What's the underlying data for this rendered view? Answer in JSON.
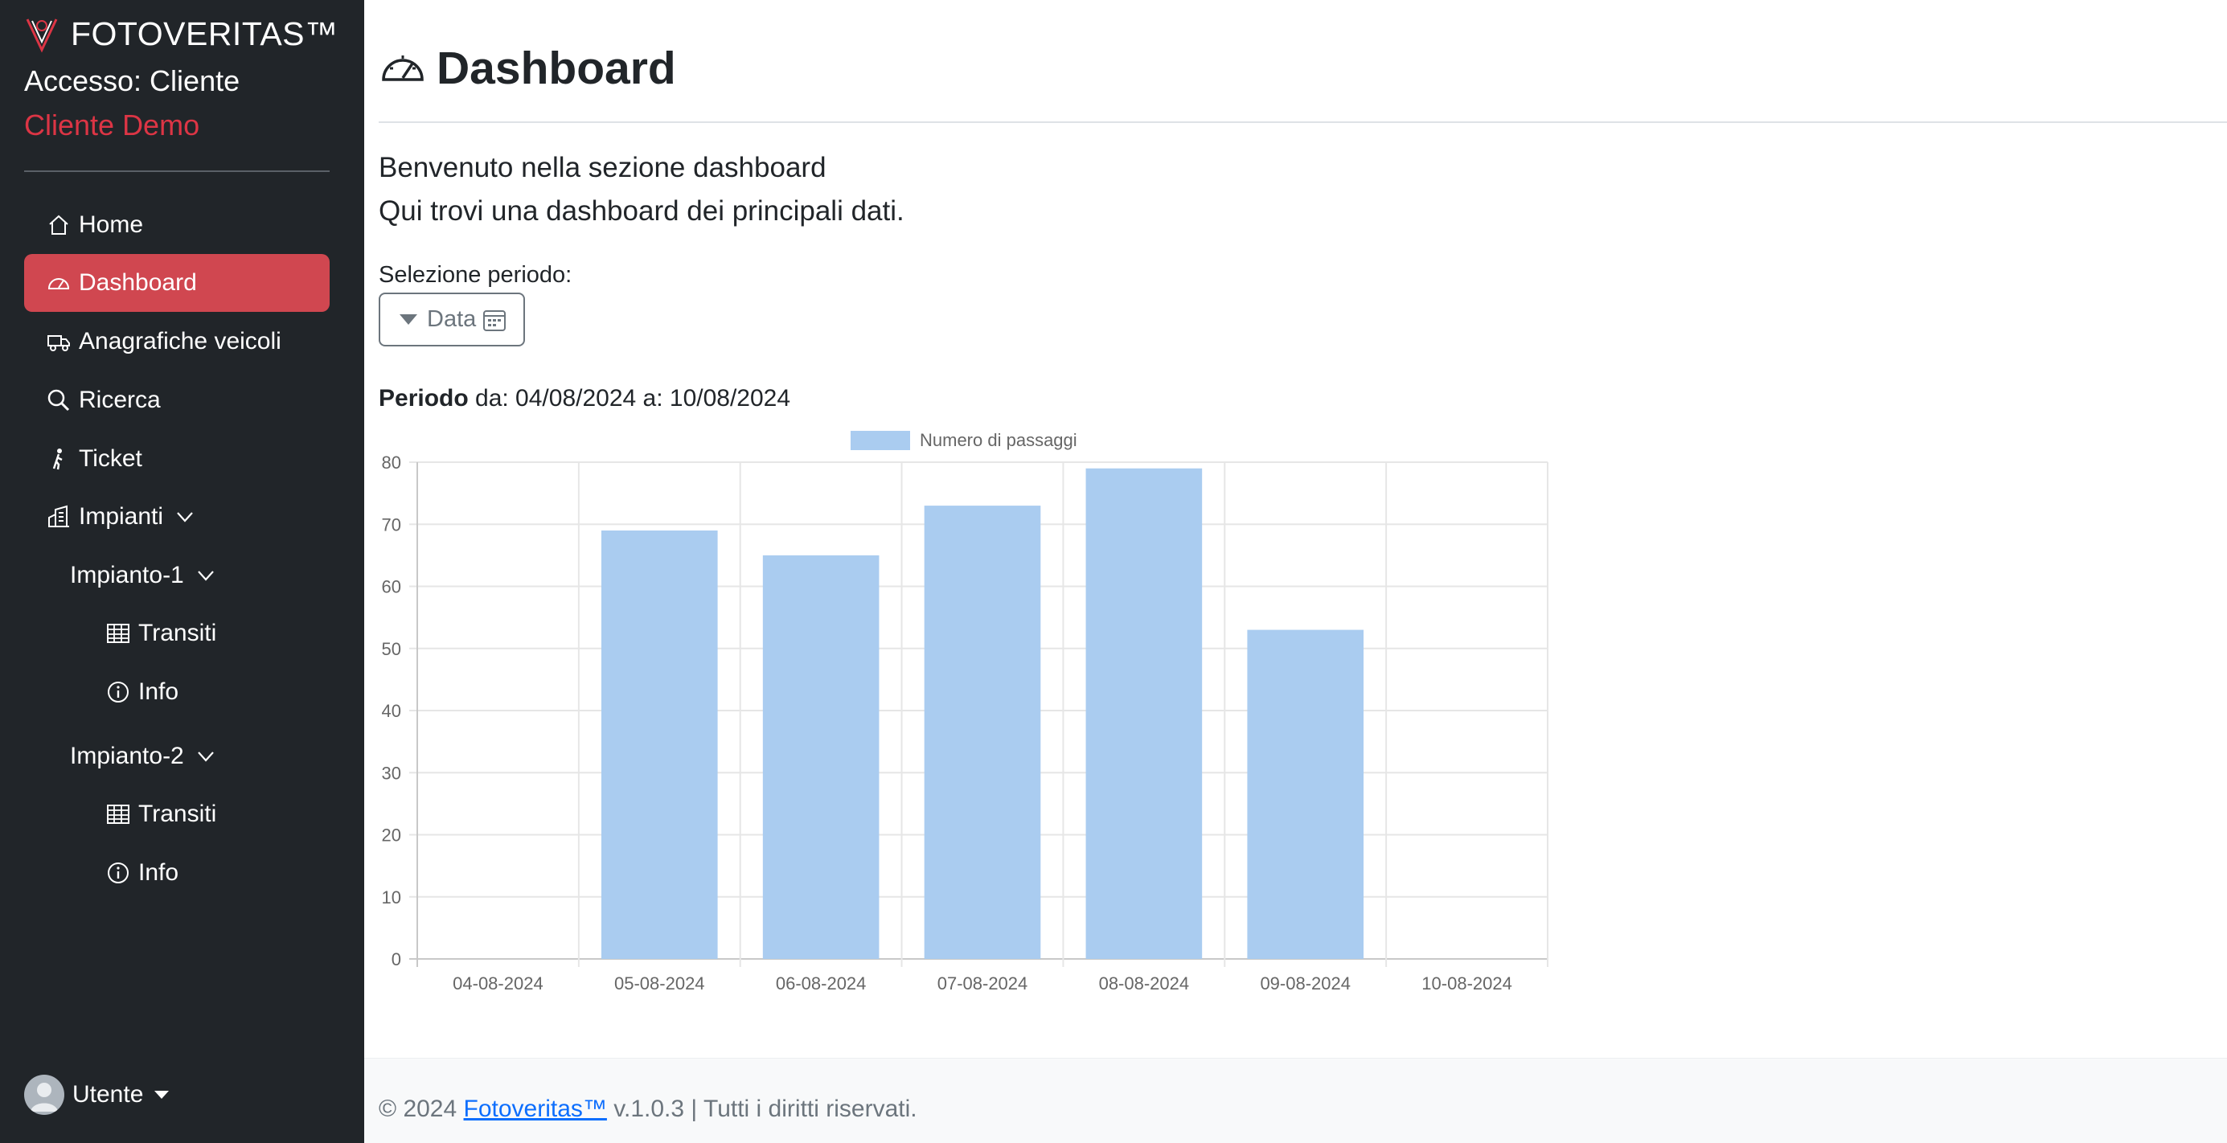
{
  "sidebar": {
    "brand": "FOTOVERITAS™",
    "access": "Accesso: Cliente",
    "client_name": "Cliente Demo",
    "items": [
      {
        "label": "Home",
        "icon": "house-icon"
      },
      {
        "label": "Dashboard",
        "icon": "speedometer-icon",
        "active": true
      },
      {
        "label": "Anagrafiche veicoli",
        "icon": "truck-icon"
      },
      {
        "label": "Ricerca",
        "icon": "search-icon"
      },
      {
        "label": "Ticket",
        "icon": "person-walking-icon"
      },
      {
        "label": "Impianti",
        "icon": "buildings-icon"
      }
    ],
    "plants": [
      {
        "label": "Impianto-1",
        "children": [
          {
            "label": "Transiti",
            "icon": "table-icon"
          },
          {
            "label": "Info",
            "icon": "info-circle-icon"
          }
        ]
      },
      {
        "label": "Impianto-2",
        "children": [
          {
            "label": "Transiti",
            "icon": "table-icon"
          },
          {
            "label": "Info",
            "icon": "info-circle-icon"
          }
        ]
      }
    ],
    "user_label": "Utente"
  },
  "main": {
    "title": "Dashboard",
    "welcome_line1": "Benvenuto nella sezione dashboard",
    "welcome_line2": "Qui trovi una dashboard dei principali dati.",
    "period_selection_label": "Selezione periodo:",
    "date_button": "Data",
    "periodo_bold": "Periodo",
    "periodo_rest": " da: 04/08/2024 a: 10/08/2024"
  },
  "chart_data": {
    "type": "bar",
    "categories": [
      "04-08-2024",
      "05-08-2024",
      "06-08-2024",
      "07-08-2024",
      "08-08-2024",
      "09-08-2024",
      "10-08-2024"
    ],
    "series": [
      {
        "name": "Numero di passaggi",
        "values": [
          0,
          69,
          65,
          73,
          79,
          53,
          0
        ]
      }
    ],
    "ylim": [
      0,
      80
    ],
    "yticks": [
      0,
      10,
      20,
      30,
      40,
      50,
      60,
      70,
      80
    ],
    "grid": true,
    "legend": "top",
    "bar_color": "#aaccf0"
  },
  "footer": {
    "prefix": "© 2024 ",
    "link": "Fotoveritas™",
    "suffix": " v.1.0.3 | Tutti i diritti riservati."
  },
  "colors": {
    "sidebar_bg": "#212529",
    "active_bg": "#d04750",
    "accent_red": "#dc3545",
    "link_blue": "#0d6efd"
  }
}
